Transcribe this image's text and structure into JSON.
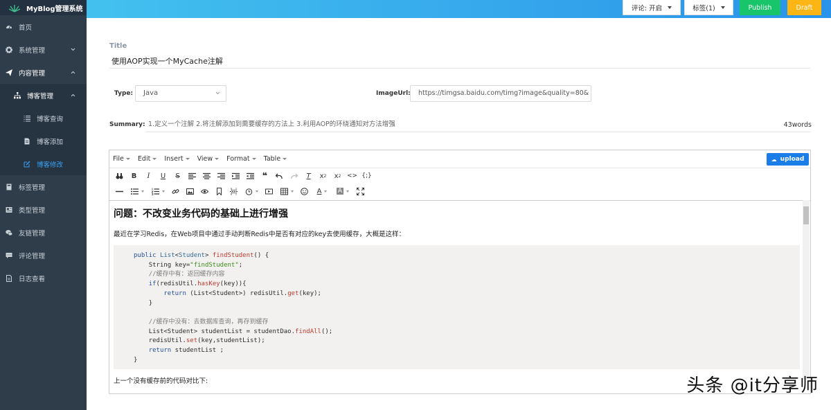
{
  "app": {
    "title": "MyBlog管理系统"
  },
  "sidebar": {
    "items": [
      {
        "label": "首页",
        "icon": "dashboard-icon"
      },
      {
        "label": "系统管理",
        "icon": "gear-icon"
      },
      {
        "label": "内容管理",
        "icon": "send-icon"
      },
      {
        "label": "博客管理",
        "icon": "sitemap-icon"
      },
      {
        "label": "博客查询",
        "icon": "list-icon"
      },
      {
        "label": "博客添加",
        "icon": "file-icon"
      },
      {
        "label": "博客修改",
        "icon": "edit-icon"
      },
      {
        "label": "标签管理",
        "icon": "book-icon"
      },
      {
        "label": "类型管理",
        "icon": "newspaper-icon"
      },
      {
        "label": "友链管理",
        "icon": "wechat-icon"
      },
      {
        "label": "评论管理",
        "icon": "comment-icon"
      },
      {
        "label": "日志查看",
        "icon": "log-icon"
      }
    ]
  },
  "header": {
    "comment_select": "评论: 开启",
    "tag_select": "标签(1)",
    "publish_label": "Publish",
    "draft_label": "Draft"
  },
  "form": {
    "title_label": "Title",
    "title_value": "使用AOP实现一个MyCache注解",
    "type_label": "Type:",
    "type_value": "Java",
    "image_label": "ImageUrl:",
    "image_value": "https://timgsa.baidu.com/timg?image&quality=80&",
    "summary_label": "Summary:",
    "summary_value": "1.定义一个注解 2.将注解添加到需要缓存的方法上 3.利用AOP的环绕通知对方法增强",
    "summary_count": "43words"
  },
  "editor": {
    "menus": [
      "File",
      "Edit",
      "Insert",
      "View",
      "Format",
      "Table"
    ],
    "upload_label": "upload",
    "heading": "问题：不改变业务代码的基础上进行增强",
    "intro": "最近在学习Redis，在Web项目中通过手动判断Redis中是否有对应的key去使用缓存，大概是这样：",
    "after_code": "上一个没有缓存前的代码对比下:",
    "code": {
      "l1_kw": "public",
      "l1_type": "List",
      "l1_gen": "Student",
      "l1_fn": "findStudent",
      "l1_tail": "() {",
      "l2_a": "String key=",
      "l2_str": "\"findStudent\"",
      "l2_b": ";",
      "l3": "//缓存中有：返回缓存内容",
      "l4_kw": "if",
      "l4_a": "(redisUtil.",
      "l4_fn": "hasKey",
      "l4_b": "(key)){",
      "l5_kw": "return",
      "l5_a": "(List<Student>) redisUtil.",
      "l5_fn": "get",
      "l5_b": "(key);",
      "l6": "}",
      "l7": "//缓存中没有：去数据库查询，再存到缓存",
      "l8_a": "List<Student> studentList = studentDao.",
      "l8_fn": "findAll",
      "l8_b": "();",
      "l9_a": "redisUtil.",
      "l9_fn": "set",
      "l9_b": "(key,studentList);",
      "l10_kw": "return",
      "l10_a": "studentList ;",
      "l11": "}"
    }
  },
  "watermark": "头条 @it分享师"
}
